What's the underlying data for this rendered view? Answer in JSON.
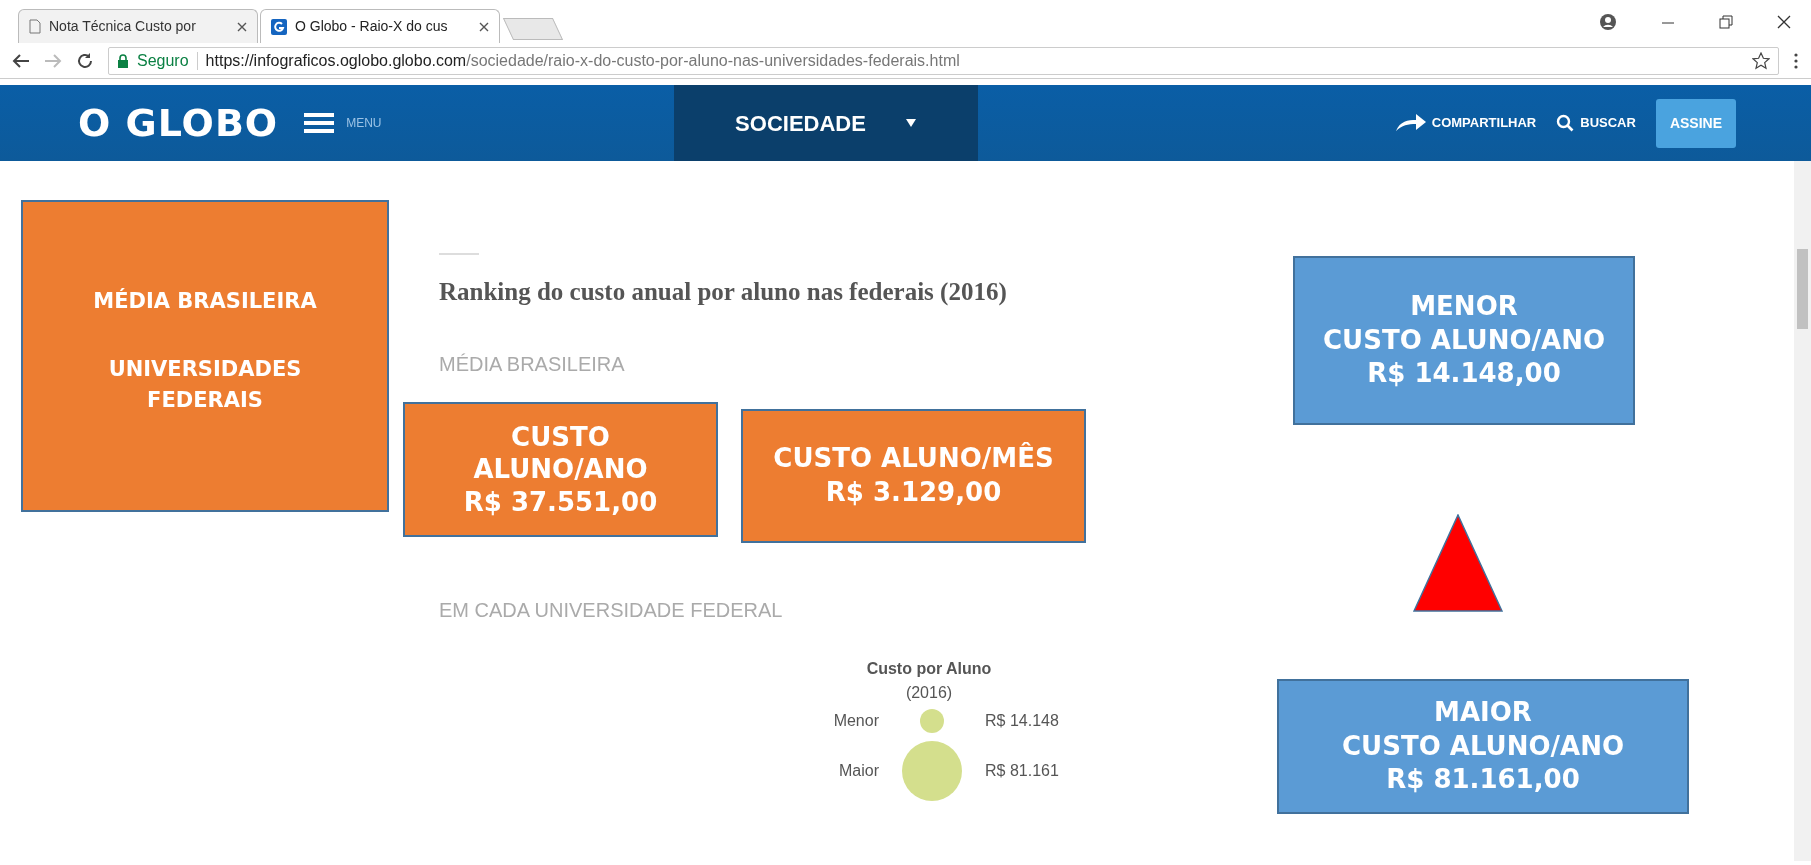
{
  "browser": {
    "tabs": [
      {
        "label": "Nota Técnica Custo por",
        "kind": "doc",
        "selected": false
      },
      {
        "label": "O Globo - Raio-X do cus",
        "kind": "site",
        "selected": true
      }
    ],
    "security": "Seguro",
    "url_host": "https://infograficos.oglobo.globo.com",
    "url_path": "/sociedade/raio-x-do-custo-por-aluno-nas-universidades-federais.html"
  },
  "site_header": {
    "logo": "O GLOBO",
    "menu": "MENU",
    "section": "SOCIEDADE",
    "share": "COMPARTILHAR",
    "search": "BUSCAR",
    "subscribe": "ASSINE"
  },
  "article": {
    "title": "Ranking do custo anual por aluno nas federais (2016)",
    "section_1": "MÉDIA BRASILEIRA",
    "section_2": "EM CADA UNIVERSIDADE FEDERAL",
    "legend": {
      "title": "Custo por Aluno",
      "subtitle": "(2016)",
      "rows": [
        {
          "label": "Menor",
          "value": "R$ 14.148",
          "kind": "small"
        },
        {
          "label": "Maior",
          "value": "R$ 81.161",
          "kind": "large"
        }
      ]
    }
  },
  "annotations": [
    {
      "color": "#ed7d31",
      "lines": [
        "MÉDIA BRASILEIRA",
        "UNIVERSIDADES FEDERAIS"
      ]
    },
    {
      "color": "#ed7d31",
      "lines": [
        "CUSTO ALUNO/ANO",
        "R$ 37.551,00"
      ]
    },
    {
      "color": "#ed7d31",
      "lines": [
        "CUSTO ALUNO/MÊS",
        "R$ 3.129,00"
      ]
    },
    {
      "color": "#5b9bd5",
      "lines": [
        "MENOR",
        "CUSTO ALUNO/ANO",
        "R$ 14.148,00"
      ]
    },
    {
      "color": "#5b9bd5",
      "lines": [
        "MAIOR",
        "CUSTO ALUNO/ANO",
        "R$ 81.161,00"
      ]
    }
  ]
}
